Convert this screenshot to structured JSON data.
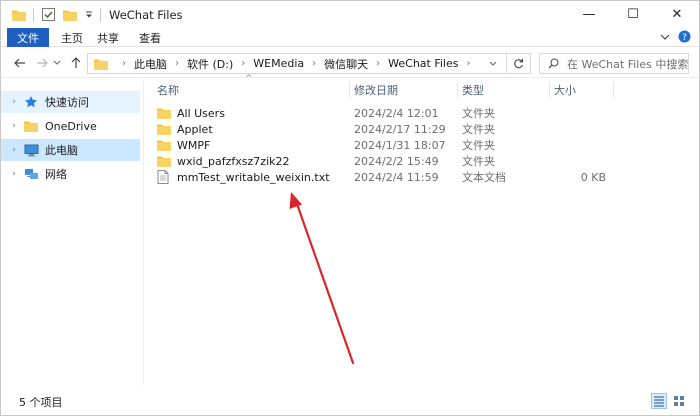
{
  "window": {
    "title": "WeChat Files",
    "controls": {
      "minimize": "—",
      "maximize": "☐",
      "close": "✕"
    }
  },
  "ribbon": {
    "tabs": [
      "文件",
      "主页",
      "共享",
      "查看"
    ]
  },
  "address": {
    "crumbs": [
      "此电脑",
      "软件 (D:)",
      "WEMedia",
      "微信聊天",
      "WeChat Files"
    ],
    "search_placeholder": "在 WeChat Files 中搜索"
  },
  "sidebar": {
    "items": [
      {
        "label": "快速访问",
        "icon": "star-icon"
      },
      {
        "label": "OneDrive",
        "icon": "folder-icon"
      },
      {
        "label": "此电脑",
        "icon": "computer-icon"
      },
      {
        "label": "网络",
        "icon": "network-icon"
      }
    ]
  },
  "columns": [
    "名称",
    "修改日期",
    "类型",
    "大小"
  ],
  "files": [
    {
      "name": "All Users",
      "date": "2024/2/4 12:01",
      "type": "文件夹",
      "size": "",
      "icon": "folder-icon"
    },
    {
      "name": "Applet",
      "date": "2024/2/17 11:29",
      "type": "文件夹",
      "size": "",
      "icon": "folder-icon"
    },
    {
      "name": "WMPF",
      "date": "2024/1/31 18:07",
      "type": "文件夹",
      "size": "",
      "icon": "folder-icon"
    },
    {
      "name": "wxid_pafzfxsz7zik22",
      "date": "2024/2/2 15:49",
      "type": "文件夹",
      "size": "",
      "icon": "folder-icon"
    },
    {
      "name": "mmTest_writable_weixin.txt",
      "date": "2024/2/4 11:59",
      "type": "文本文档",
      "size": "0 KB",
      "icon": "text-file-icon"
    }
  ],
  "status": {
    "item_count": "5 个项目"
  },
  "colors": {
    "accent": "#1f5fbf",
    "folder": "#f4c443",
    "selection": "#cce8ff",
    "annotation_arrow": "#d9262b"
  }
}
